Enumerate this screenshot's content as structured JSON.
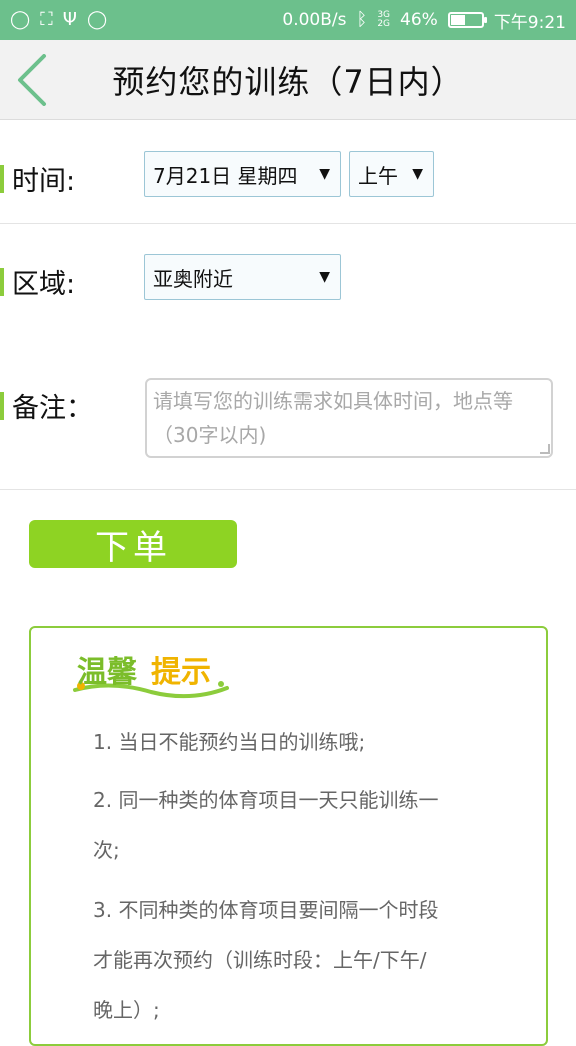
{
  "status": {
    "speed": "0.00B/s",
    "network": "3G 2G",
    "battery": "46%",
    "battery_level": 0.46,
    "time": "下午9:21"
  },
  "header": {
    "title": "预约您的训练（7日内）"
  },
  "form": {
    "time_label": "时间:",
    "date_value": "7月21日 星期四",
    "period_value": "上午",
    "area_label": "区域:",
    "area_value": "亚奥附近",
    "note_label": "备注：",
    "note_placeholder": "请填写您的训练需求如具体时间，地点等（30字以内)"
  },
  "order_button": "下单",
  "tips": {
    "logo_text": "温馨提示",
    "lines": [
      "1. 当日不能预约当日的训练哦;",
      "2. 同一种类的体育项目一天只能训练一",
      "次;",
      "3. 不同种类的体育项目要间隔一个时段",
      "才能再次预约（训练时段：上午/下午/",
      "晚上）;"
    ]
  },
  "colors": {
    "statusbar": "#6cc08c",
    "accent_green": "#8ed323",
    "border_green": "#8ccc3c"
  }
}
